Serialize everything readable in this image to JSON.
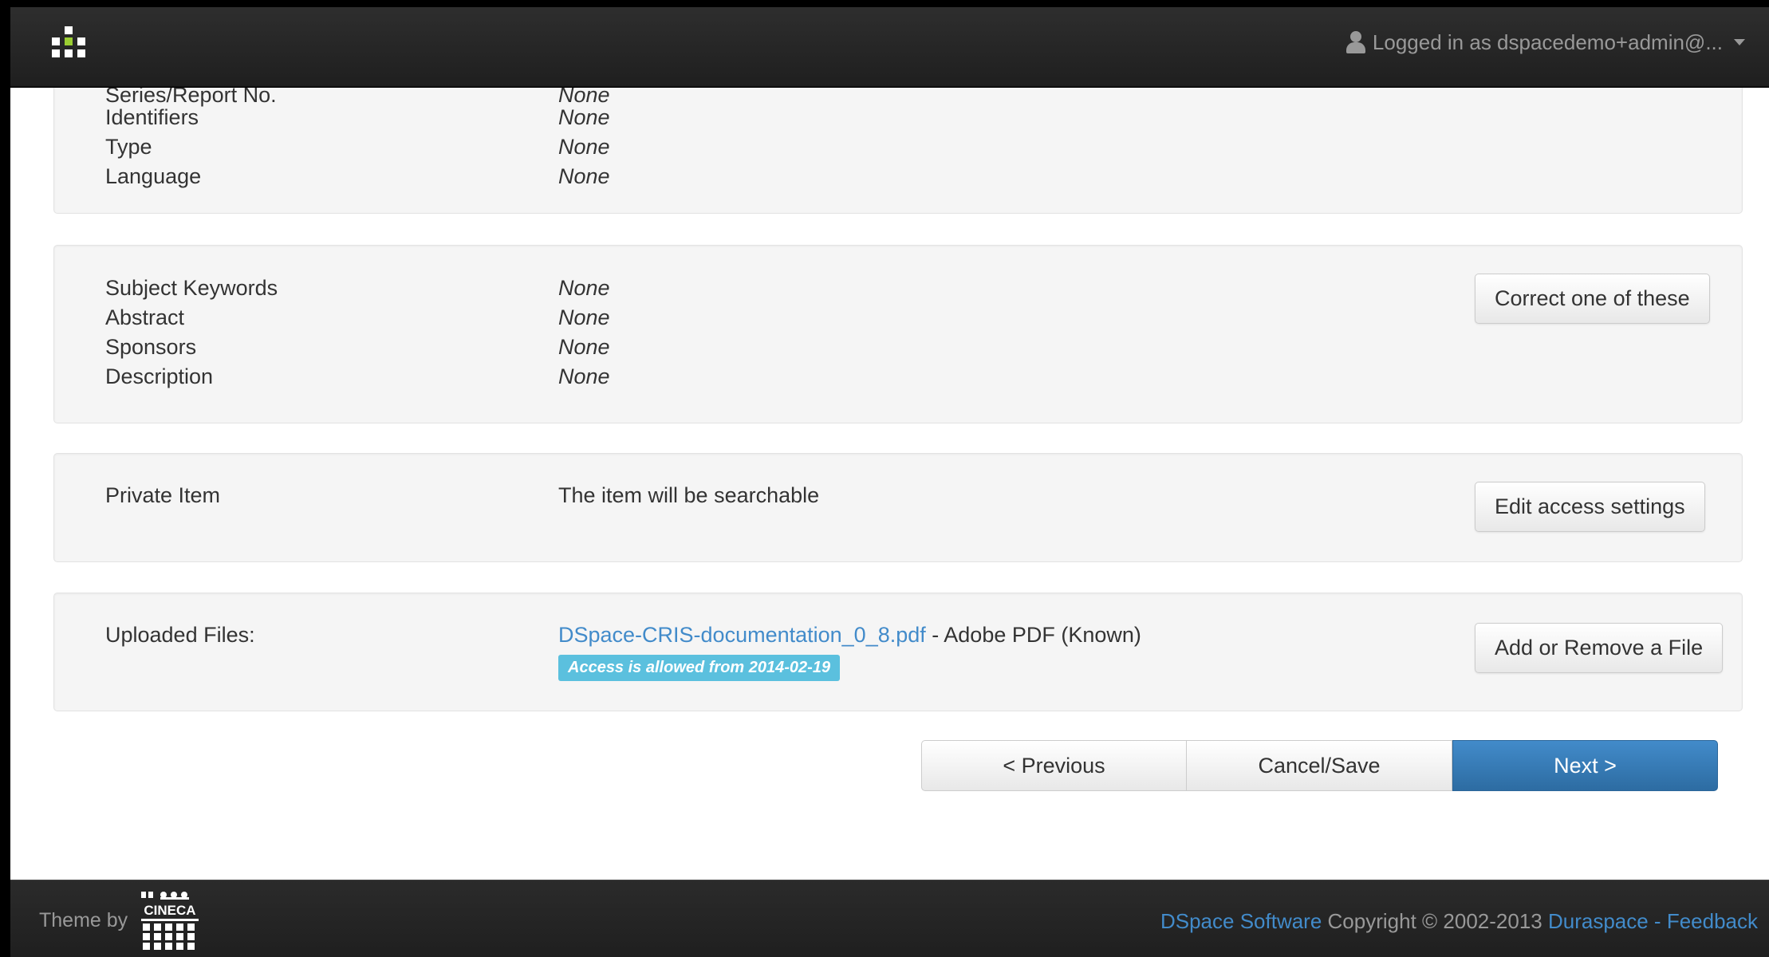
{
  "navbar": {
    "brand_icon": "dspace-logo-icon",
    "user_label": "Logged in as dspacedemo+admin@...",
    "user_icon": "user-icon",
    "caret_icon": "chevron-down-icon"
  },
  "sections": {
    "item_info": {
      "partial_label": "Series/Report No.",
      "partial_value": "None",
      "rows": [
        {
          "label": "Identifiers",
          "value": "None"
        },
        {
          "label": "Type",
          "value": "None"
        },
        {
          "label": "Language",
          "value": "None"
        }
      ]
    },
    "description": {
      "rows": [
        {
          "label": "Subject Keywords",
          "value": "None"
        },
        {
          "label": "Abstract",
          "value": "None"
        },
        {
          "label": "Sponsors",
          "value": "None"
        },
        {
          "label": "Description",
          "value": "None"
        }
      ],
      "button": "Correct one of these"
    },
    "access": {
      "label": "Private Item",
      "value": "The item will be searchable",
      "button": "Edit access settings"
    },
    "files": {
      "label": "Uploaded Files:",
      "file_name": "DSpace-CRIS-documentation_0_8.pdf",
      "file_type": " - Adobe PDF (Known)",
      "access_badge": "Access is allowed from 2014-02-19",
      "button": "Add or Remove a File"
    }
  },
  "navigation": {
    "previous": "< Previous",
    "cancel_save": "Cancel/Save",
    "next": "Next >"
  },
  "footer": {
    "theme_by": "Theme by",
    "logo_text": "CINECA",
    "dspace_link": "DSpace Software",
    "copyright": " Copyright © 2002-2013 ",
    "duraspace_link": "Duraspace",
    "separator": " - ",
    "feedback_link": "Feedback"
  },
  "colors": {
    "navbar_bg": "#222222",
    "well_bg": "#f5f5f5",
    "link": "#428bca",
    "primary": "#428bca",
    "badge_info": "#5bc0de"
  }
}
